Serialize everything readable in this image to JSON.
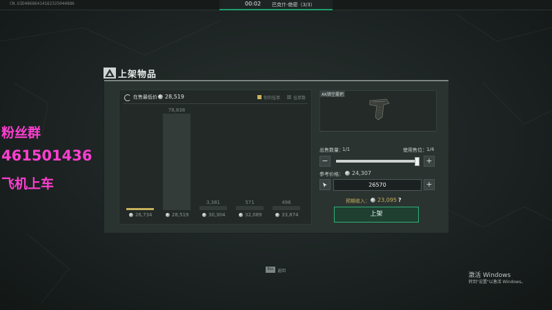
{
  "topbar": {
    "uid": "CN.UID48686414162325044886",
    "time": "00:02",
    "map": "巴克什-绝密（3/3）",
    "accent_color": "#1ea06c"
  },
  "dialog": {
    "title": "上架物品",
    "title_icon": "warning-triangle-icon"
  },
  "market": {
    "lowest_label": "在售最低价",
    "lowest_value": "28,519",
    "legend_mine": "你的挂单",
    "legend_count": "挂单数",
    "mine_color": "#c9b25c"
  },
  "chart_data": {
    "type": "bar",
    "categories": [
      "26,734",
      "28,519",
      "30,304",
      "32,089",
      "33,874"
    ],
    "values": [
      0,
      78838,
      3381,
      571,
      496
    ],
    "value_labels": [
      "",
      "78,838",
      "3,381",
      "571",
      "496"
    ],
    "highlight_index": 0,
    "highlight_label": "你的挂单"
  },
  "item": {
    "name": "AK猎空握把",
    "icon": "grip-icon"
  },
  "listing": {
    "qty_label": "出售数量：",
    "qty_value": "1/1",
    "durability_label": "使用售位：",
    "durability_value": "1/4",
    "slider_value": 1,
    "ref_label": "参考价格：",
    "ref_value": "24,307",
    "price_value": "26570",
    "income_label": "预期收入：",
    "income_value": "23,095",
    "help": "?",
    "list_button": "上架",
    "minus": "−",
    "plus": "+"
  },
  "watermark": {
    "line1": "粉丝群",
    "line2": "461501436",
    "line3": "飞机上车",
    "color": "#ff3fd2"
  },
  "footer": {
    "esc_key": "Esc",
    "esc_label": "返回"
  },
  "windows": {
    "title": "激活 Windows",
    "subtitle": "转到\"设置\"以激活 Windows。"
  }
}
